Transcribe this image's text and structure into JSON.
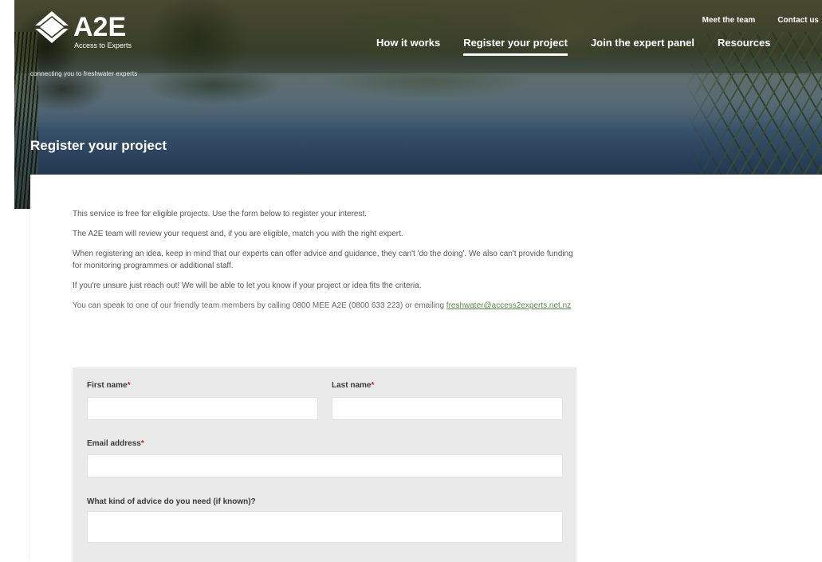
{
  "brand": {
    "name": "A2E",
    "subtitle": "Access to Experts",
    "tagline": "connecting you to freshwater experts"
  },
  "topnav": {
    "items": [
      "Meet the team",
      "Contact us"
    ]
  },
  "mainnav": {
    "items": [
      "How it works",
      "Register your project",
      "Join the expert panel",
      "Resources"
    ],
    "active": "Register your project"
  },
  "page": {
    "title": "Register your project"
  },
  "intro": {
    "p1": "This service is free for eligible projects. Use the form below to register your interest.",
    "p2": "The A2E team will review your request and, if you are eligible, match you with the right expert.",
    "p3": "When registering an idea, keep in mind that our experts can offer advice and guidance, they can't 'do the doing'. We also can't provide funding for monitoring programmes or additional staff.",
    "p4": "If you're unsure just reach out! We will be able to let you know if your project or idea fits the criteria.",
    "p5": "You can speak to one of our friendly team members by calling 0800 MEE A2E (0800 633 223) or emailing",
    "email": "freshwater@access2experts.net.nz"
  },
  "form": {
    "first_name_label": "First name",
    "last_name_label": "Last name",
    "email_label": "Email address",
    "advice_label": "What kind of advice do you need (if known)?",
    "required_mark": "*",
    "first_name_value": "",
    "last_name_value": "",
    "email_value": "",
    "advice_value": ""
  },
  "colors": {
    "required": "#d2232a",
    "form_background": "#eaeaea",
    "link": "#5a8a4a"
  }
}
